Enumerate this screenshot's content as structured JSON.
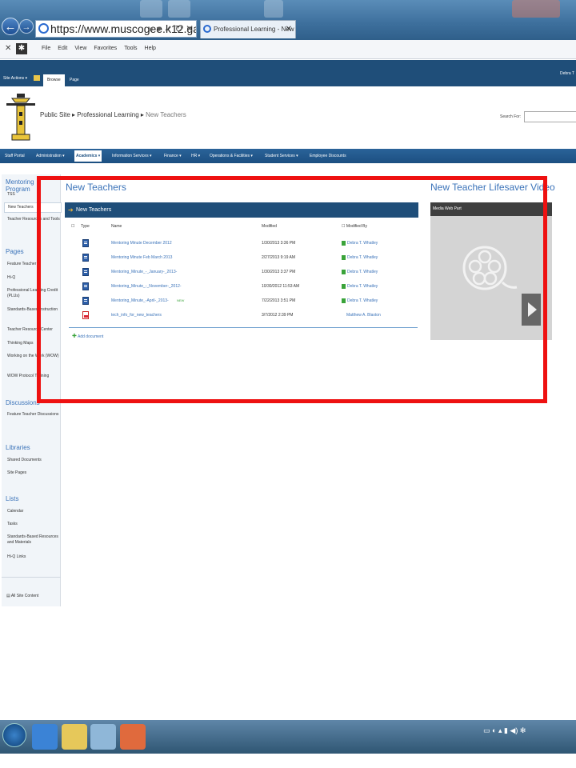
{
  "browser": {
    "url": "https://www.muscogee.k12.ga.us/",
    "tab_title": "Professional Learning - New Teac...",
    "menus": [
      "File",
      "Edit",
      "View",
      "Favorites",
      "Tools",
      "Help"
    ]
  },
  "ribbon": {
    "site_actions": "Site Actions ▾",
    "tabs": [
      "Browse",
      "Page"
    ],
    "user": "Debra T"
  },
  "breadcrumb": {
    "items": [
      "Public Site",
      "Professional Learning",
      "New Teachers"
    ],
    "separator": "▸"
  },
  "search": {
    "label": "Search For:"
  },
  "topnav": [
    "Staff Portal",
    "Administration ▾",
    "Academics ▾",
    "Information Services ▾",
    "Finance ▾",
    "HR ▾",
    "Operations & Facilities ▾",
    "Student Services ▾",
    "Employee Discounts"
  ],
  "leftnav": {
    "mentoring_heading": "Mentoring Program",
    "mentoring_items": [
      "TSS",
      "New Teachers",
      "Teacher Resources and Tools"
    ],
    "pages_heading": "Pages",
    "pages_items": [
      "Feature Teacher",
      "Hi-Q",
      "Professional Learning Credit (PLUs)",
      "Standards-Based Instruction",
      "Teacher Resource Center",
      "Thinking Maps",
      "Working on the Work (WOW)",
      "WOW Protocol Training"
    ],
    "discussions_heading": "Discussions",
    "discussions_items": [
      "Feature Teacher Discussions"
    ],
    "libraries_heading": "Libraries",
    "libraries_items": [
      "Shared Documents",
      "Site Pages"
    ],
    "lists_heading": "Lists",
    "lists_items": [
      "Calendar",
      "Tasks",
      "Standards-Based Resources and Materials",
      "Hi-Q Links"
    ],
    "all_content": "All Site Content"
  },
  "main": {
    "title": "New Teachers",
    "library_title": "New Teachers",
    "columns": [
      "Type",
      "Name",
      "Modified",
      "Modified By"
    ],
    "rows": [
      {
        "type": "doc",
        "name": "Mentoring Minute December 2012",
        "modified": "1/30/2013 3:36 PM",
        "by": "Debra T. Whatley",
        "new": ""
      },
      {
        "type": "doc",
        "name": "Mentoring Minute Feb March 2013",
        "modified": "2/27/2013 9:19 AM",
        "by": "Debra T. Whatley",
        "new": ""
      },
      {
        "type": "doc",
        "name": "Mentoring_Minute_-_January-_2013-",
        "modified": "1/30/2013 3:37 PM",
        "by": "Debra T. Whatley",
        "new": ""
      },
      {
        "type": "doc",
        "name": "Mentoring_Minute_-_November-_2012-",
        "modified": "10/30/2012 11:53 AM",
        "by": "Debra T. Whatley",
        "new": ""
      },
      {
        "type": "doc",
        "name": "Mentoring_Minute_-April-_2013-",
        "modified": "7/22/2013 3:51 PM",
        "by": "Debra T. Whatley",
        "new": "NEW"
      },
      {
        "type": "pdf",
        "name": "tech_info_for_new_teachers",
        "modified": "3/7/2012 2:39 PM",
        "by": "Matthew A. Blaxton",
        "new": ""
      }
    ],
    "add_document": "Add document"
  },
  "video": {
    "title": "New Teacher Lifesaver Video",
    "bar": "Media Web Part"
  },
  "colors": {
    "accent": "#1f4e79",
    "link": "#3b73b9",
    "highlight": "#e11111"
  }
}
